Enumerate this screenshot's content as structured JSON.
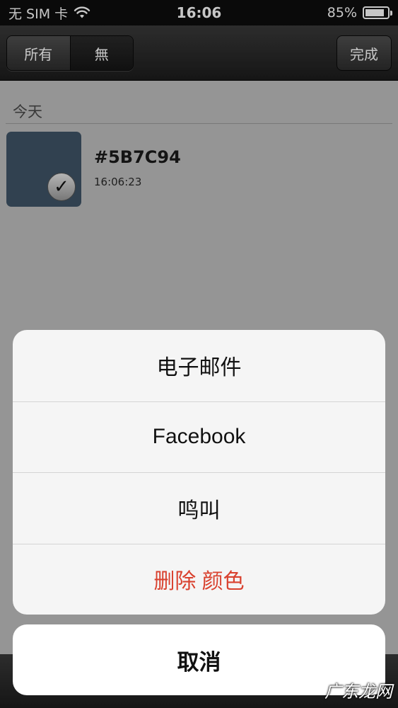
{
  "status_bar": {
    "carrier": "无 SIM 卡",
    "time": "16:06",
    "battery_percent_label": "85%",
    "battery_level": 0.85,
    "wifi_icon": "wifi-icon",
    "battery_icon": "battery-icon"
  },
  "nav_bar": {
    "segments": [
      {
        "label": "所有",
        "selected": false
      },
      {
        "label": "無",
        "selected": true
      }
    ],
    "done_label": "完成"
  },
  "list": {
    "section_title": "今天",
    "items": [
      {
        "hex": "#5B7C94",
        "time": "16:06:23",
        "swatch_color": "#3f5467",
        "checked": true,
        "check_icon": "checkmark-icon"
      }
    ]
  },
  "action_sheet": {
    "items": [
      {
        "label": "电子邮件",
        "destructive": false
      },
      {
        "label": "Facebook",
        "destructive": false
      },
      {
        "label": "鸣叫",
        "destructive": false
      },
      {
        "label": "删除 颜色",
        "destructive": true
      }
    ],
    "cancel_label": "取消",
    "destructive_color": "#d9412e"
  },
  "watermark": "广东龙网"
}
